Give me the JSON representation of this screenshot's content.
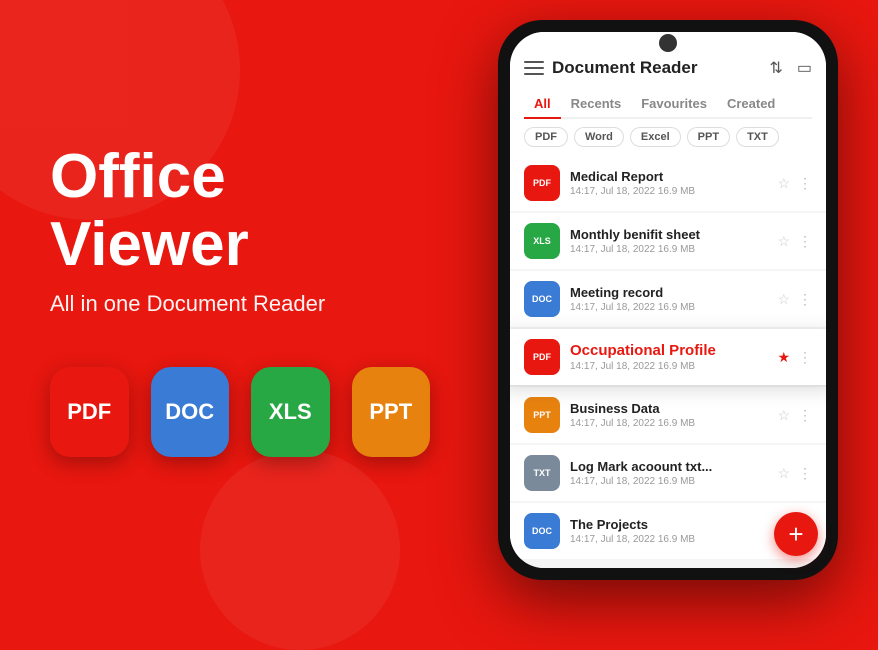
{
  "left": {
    "title": "Office Viewer",
    "subtitle": "All in one Document Reader",
    "icons": [
      {
        "id": "pdf-icon",
        "label": "PDF",
        "class": "icon-pdf"
      },
      {
        "id": "doc-icon",
        "label": "DOC",
        "class": "icon-doc"
      },
      {
        "id": "xls-icon",
        "label": "XLS",
        "class": "icon-xls"
      },
      {
        "id": "ppt-icon",
        "label": "PPT",
        "class": "icon-ppt"
      }
    ]
  },
  "app": {
    "header": {
      "title": "Document Reader",
      "sort_icon": "↑↓",
      "folder_icon": "🗂"
    },
    "tabs": [
      {
        "id": "all",
        "label": "All",
        "active": true
      },
      {
        "id": "recents",
        "label": "Recents",
        "active": false
      },
      {
        "id": "favourites",
        "label": "Favourites",
        "active": false
      },
      {
        "id": "created",
        "label": "Created",
        "active": false
      }
    ],
    "filters": [
      {
        "id": "pdf",
        "label": "PDF",
        "active": false
      },
      {
        "id": "word",
        "label": "Word",
        "active": false
      },
      {
        "id": "excel",
        "label": "Excel",
        "active": false
      },
      {
        "id": "ppt",
        "label": "PPT",
        "active": false
      },
      {
        "id": "txt",
        "label": "TXT",
        "active": false
      }
    ],
    "files": [
      {
        "id": "medical-report",
        "name": "Medical Report",
        "meta": "14:17, Jul 18, 2022  16.9 MB",
        "type": "PDF",
        "badge": "badge-pdf",
        "starred": false,
        "highlighted": false
      },
      {
        "id": "monthly-benefit",
        "name": "Monthly benifit sheet",
        "meta": "14:17, Jul 18, 2022  16.9 MB",
        "type": "XLS",
        "badge": "badge-xls",
        "starred": false,
        "highlighted": false
      },
      {
        "id": "meeting-record",
        "name": "Meeting record",
        "meta": "14:17, Jul 18, 2022  16.9 MB",
        "type": "DOC",
        "badge": "badge-doc",
        "starred": false,
        "highlighted": false
      },
      {
        "id": "occupational-profile",
        "name": "Occupational Profile",
        "meta": "14:17, Jul 18, 2022  16.9 MB",
        "type": "PDF",
        "badge": "badge-pdf",
        "starred": true,
        "highlighted": true
      },
      {
        "id": "business-data",
        "name": "Business Data",
        "meta": "14:17, Jul 18, 2022  16.9 MB",
        "type": "PPT",
        "badge": "badge-ppt",
        "starred": false,
        "highlighted": false
      },
      {
        "id": "log-mark",
        "name": "Log Mark acoount txt...",
        "meta": "14:17, Jul 18, 2022  16.9 MB",
        "type": "TXT",
        "badge": "badge-txt",
        "starred": false,
        "highlighted": false
      },
      {
        "id": "the-projects",
        "name": "The Projects",
        "meta": "14:17, Jul 18, 2022  16.9 MB",
        "type": "DOC",
        "badge": "badge-doc",
        "starred": false,
        "highlighted": false
      }
    ],
    "fab_label": "+"
  }
}
